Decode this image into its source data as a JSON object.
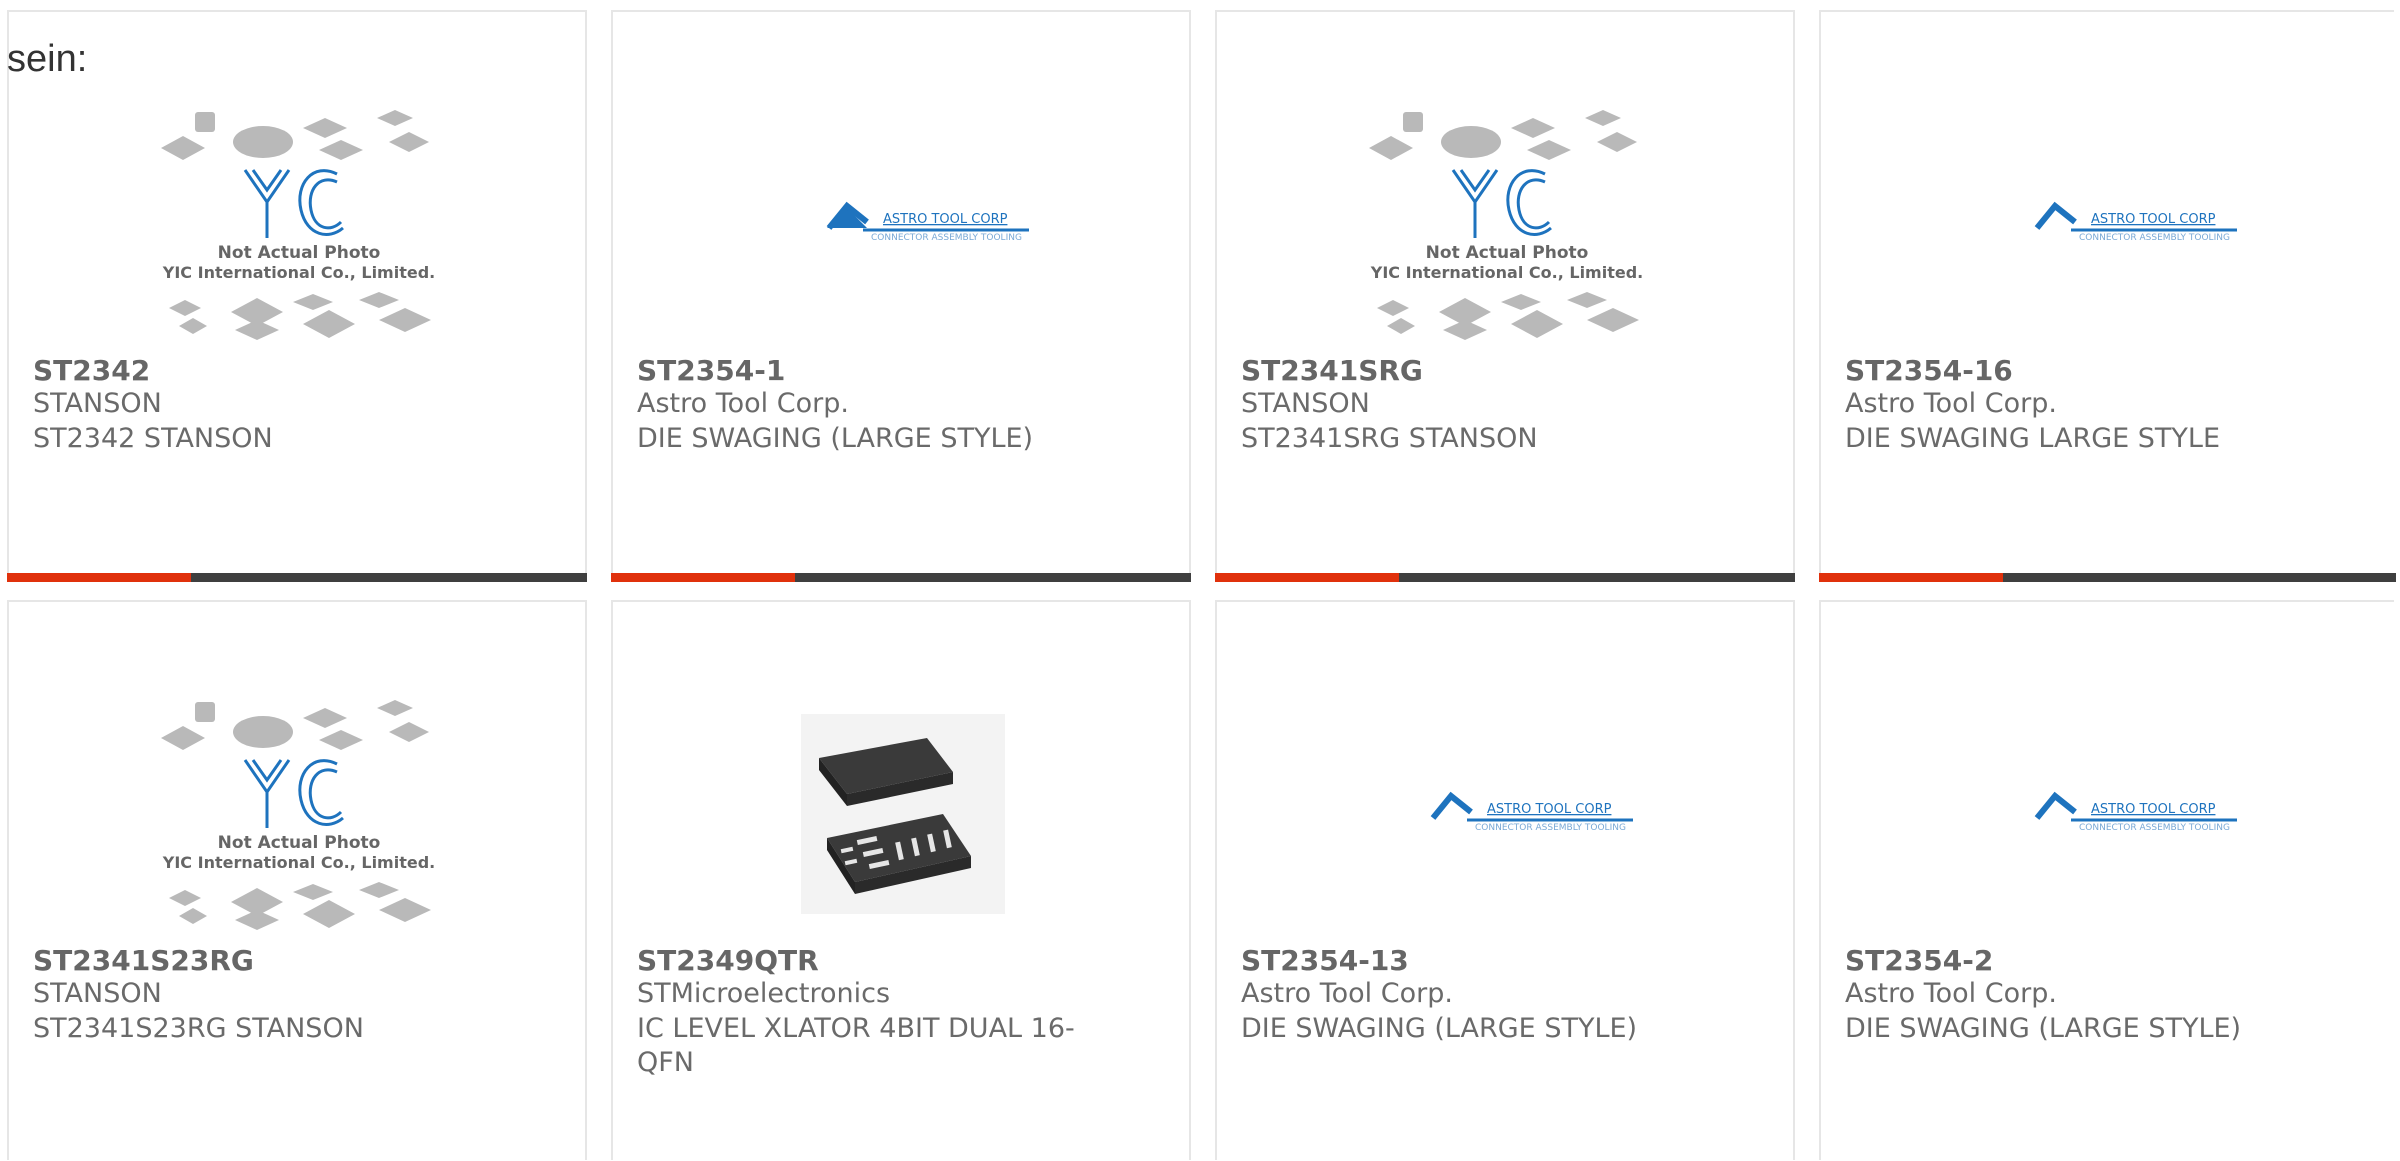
{
  "intro_text": "sein:",
  "products": [
    {
      "part": "ST2342",
      "maker": "STANSON",
      "desc": "ST2342 STANSON",
      "image": "yic-placeholder"
    },
    {
      "part": "ST2354-1",
      "maker": "Astro Tool Corp.",
      "desc": "DIE SWAGING (LARGE STYLE)",
      "image": "astro-tool-logo"
    },
    {
      "part": "ST2341SRG",
      "maker": "STANSON",
      "desc": "ST2341SRG STANSON",
      "image": "yic-placeholder"
    },
    {
      "part": "ST2354-16",
      "maker": "Astro Tool Corp.",
      "desc": "DIE SWAGING LARGE STYLE",
      "image": "astro-tool-logo"
    },
    {
      "part": "ST2341S23RG",
      "maker": "STANSON",
      "desc": "ST2341S23RG STANSON",
      "image": "yic-placeholder"
    },
    {
      "part": "ST2349QTR",
      "maker": "STMicroelectronics",
      "desc": "IC LEVEL XLATOR 4BIT DUAL 16-QFN",
      "image": "qfn-chip"
    },
    {
      "part": "ST2354-13",
      "maker": "Astro Tool Corp.",
      "desc": "DIE SWAGING (LARGE STYLE)",
      "image": "astro-tool-logo"
    },
    {
      "part": "ST2354-2",
      "maker": "Astro Tool Corp.",
      "desc": "DIE SWAGING (LARGE STYLE)",
      "image": "astro-tool-logo"
    }
  ],
  "placeholder": {
    "line1": "Not Actual Photo",
    "line2": "YIC International Co., Limited.",
    "logo": "YIC"
  },
  "astro_logo": {
    "name": "ASTRO TOOL CORP",
    "tagline": "CONNECTOR ASSEMBLY TOOLING"
  },
  "colors": {
    "accent": "#e0310c",
    "bar": "#3f3f3f",
    "yic_blue": "#1e73be"
  }
}
